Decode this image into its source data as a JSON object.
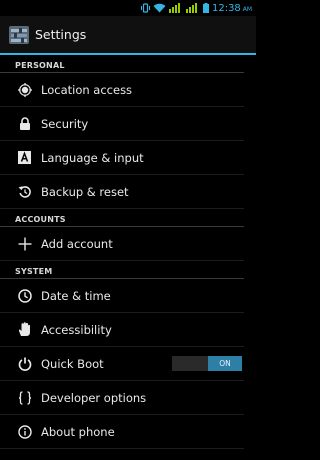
{
  "status_bar": {
    "time": "12:38",
    "ampm": "AM",
    "icons": [
      "vibrate-icon",
      "wifi-icon",
      "signal-icon",
      "signal-icon",
      "battery-icon"
    ],
    "accent": "#33b5e5"
  },
  "action_bar": {
    "title": "Settings",
    "icon": "settings-app-icon"
  },
  "sections": {
    "personal": "PERSONAL",
    "accounts": "ACCOUNTS",
    "system": "SYSTEM"
  },
  "items": {
    "location": {
      "label": "Location access",
      "icon": "location-icon"
    },
    "security": {
      "label": "Security",
      "icon": "lock-icon"
    },
    "language": {
      "label": "Language & input",
      "icon": "keyboard-icon"
    },
    "backup": {
      "label": "Backup & reset",
      "icon": "restore-icon"
    },
    "add_account": {
      "label": "Add account",
      "icon": "plus-icon"
    },
    "date_time": {
      "label": "Date & time",
      "icon": "clock-icon"
    },
    "accessibility": {
      "label": "Accessibility",
      "icon": "hand-icon"
    },
    "quick_boot": {
      "label": "Quick Boot",
      "icon": "power-icon",
      "toggle": "ON"
    },
    "developer": {
      "label": "Developer options",
      "icon": "braces-icon"
    },
    "about": {
      "label": "About phone",
      "icon": "info-icon"
    }
  }
}
